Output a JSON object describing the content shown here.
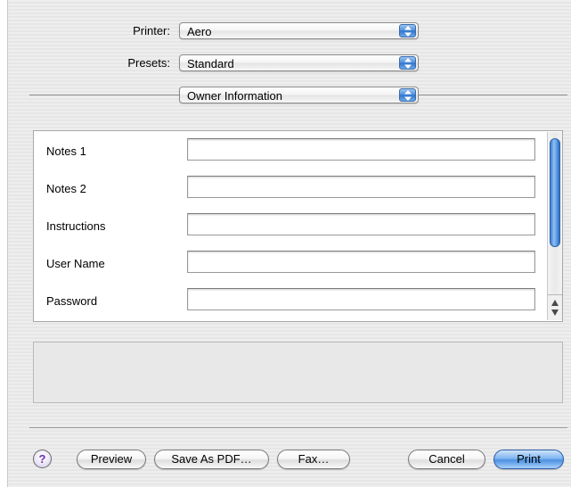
{
  "printer": {
    "label": "Printer:",
    "value": "Aero"
  },
  "presets": {
    "label": "Presets:",
    "value": "Standard"
  },
  "pane_selector": {
    "value": "Owner Information"
  },
  "fields": [
    {
      "label": "Notes 1",
      "value": ""
    },
    {
      "label": "Notes 2",
      "value": ""
    },
    {
      "label": "Instructions",
      "value": ""
    },
    {
      "label": "User Name",
      "value": ""
    },
    {
      "label": "Password",
      "value": ""
    }
  ],
  "icons": {
    "popup_arrows": "up-down-arrows-icon",
    "help": "question-mark-icon",
    "scroll_up": "scroll-up-arrow-icon",
    "scroll_down": "scroll-down-arrow-icon"
  },
  "buttons": {
    "help": "?",
    "preview": "Preview",
    "save_pdf": "Save As PDF…",
    "fax": "Fax…",
    "cancel": "Cancel",
    "print": "Print"
  },
  "colors": {
    "accent": "#4c92e2",
    "help_glyph": "#6b2fb5"
  }
}
